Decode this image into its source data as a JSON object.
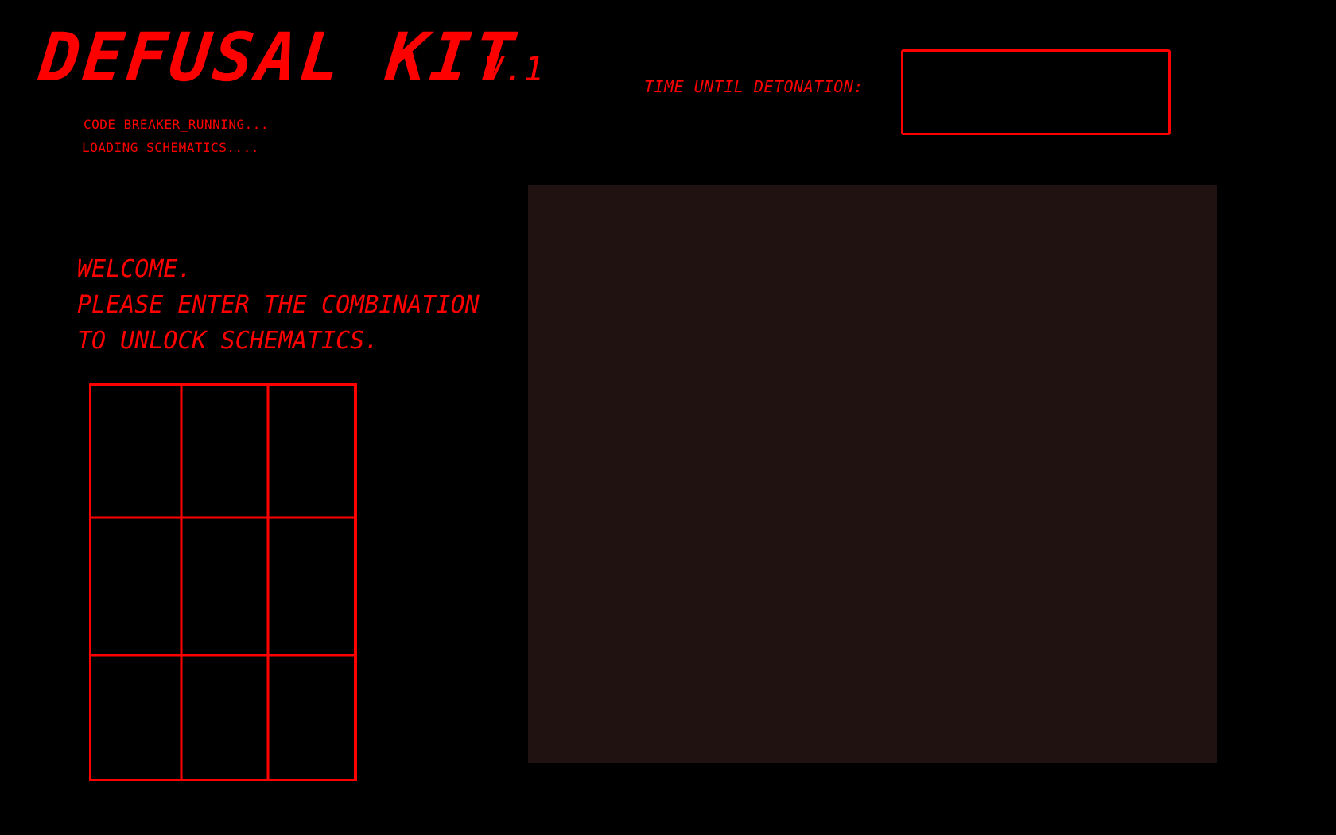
{
  "header": {
    "title": "DEFUSAL KIT",
    "version": "V.1"
  },
  "status": {
    "line1": "CODE BREAKER_RUNNING...",
    "line2": "LOADING SCHEMATICS...."
  },
  "timer": {
    "label": "TIME UNTIL DETONATION:",
    "value": ""
  },
  "welcome": {
    "line1": "WELCOME.",
    "line2": "PLEASE ENTER THE COMBINATION",
    "line3": "TO UNLOCK SCHEMATICS."
  },
  "keypad": {
    "rows": 3,
    "columns": 3,
    "keys": [
      "",
      "",
      "",
      "",
      "",
      "",
      "",
      "",
      ""
    ]
  },
  "colors": {
    "background": "#000000",
    "accent": "#ff0000",
    "panel": "#211212"
  }
}
